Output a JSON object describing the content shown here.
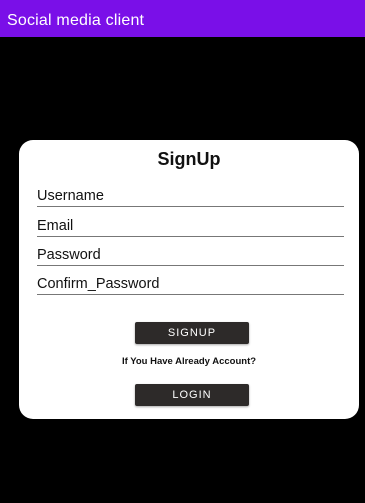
{
  "app_bar": {
    "title": "Social media client",
    "color": "#7a0fe8"
  },
  "form": {
    "title": "SignUp",
    "fields": {
      "username_placeholder": "Username",
      "email_placeholder": "Email",
      "password_placeholder": "Password",
      "confirm_password_placeholder": "Confirm_Password"
    },
    "signup_label": "SIGNUP",
    "login_prompt": "If You Have Already Account?",
    "login_label": "LOGIN"
  }
}
